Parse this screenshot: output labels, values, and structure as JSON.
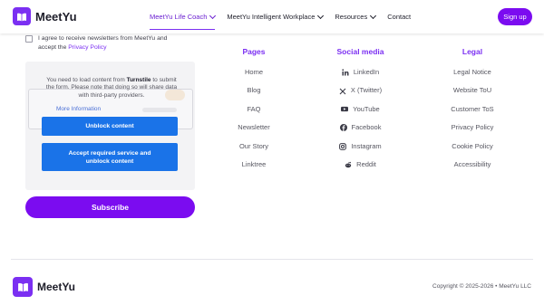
{
  "brand": {
    "name": "MeetYu",
    "accent": "#7b2ff2",
    "button": "#7b0cf0"
  },
  "nav": {
    "items": [
      {
        "label": "MeetYu Life Coach",
        "active": true,
        "dropdown": true
      },
      {
        "label": "MeetYu Intelligent Workplace",
        "active": false,
        "dropdown": true
      },
      {
        "label": "Resources",
        "active": false,
        "dropdown": true
      },
      {
        "label": "Contact",
        "active": false,
        "dropdown": false
      }
    ],
    "signup_label": "Sign up"
  },
  "form": {
    "consent_text": "I agree to receive newsletters from MeetYu and accept the",
    "consent_link": "Privacy Policy",
    "turnstile": {
      "msg_prefix": "You need to load content from",
      "msg_provider": "Turnstile",
      "msg_suffix": "to submit the form. Please note that doing so will share data with third-party providers.",
      "more_info": "More Information",
      "unblock_label": "Unblock content",
      "accept_label": "Accept required service and unblock content",
      "button_color": "#1a73e8"
    },
    "subscribe_label": "Subscribe"
  },
  "footer": {
    "pages": {
      "title": "Pages",
      "items": [
        "Home",
        "Blog",
        "FAQ",
        "Newsletter",
        "Our Story",
        "Linktree"
      ]
    },
    "social": {
      "title": "Social media",
      "items": [
        {
          "label": "LinkedIn",
          "icon": "linkedin-icon"
        },
        {
          "label": "X (Twitter)",
          "icon": "x-icon"
        },
        {
          "label": "YouTube",
          "icon": "youtube-icon"
        },
        {
          "label": "Facebook",
          "icon": "facebook-icon"
        },
        {
          "label": "Instagram",
          "icon": "instagram-icon"
        },
        {
          "label": "Reddit",
          "icon": "reddit-icon"
        }
      ]
    },
    "legal": {
      "title": "Legal",
      "items": [
        "Legal Notice",
        "Website ToU",
        "Customer ToS",
        "Privacy Policy",
        "Cookie Policy",
        "Accessibility"
      ]
    },
    "copyright": "Copyright © 2025-2026 • MeetYu LLC"
  }
}
